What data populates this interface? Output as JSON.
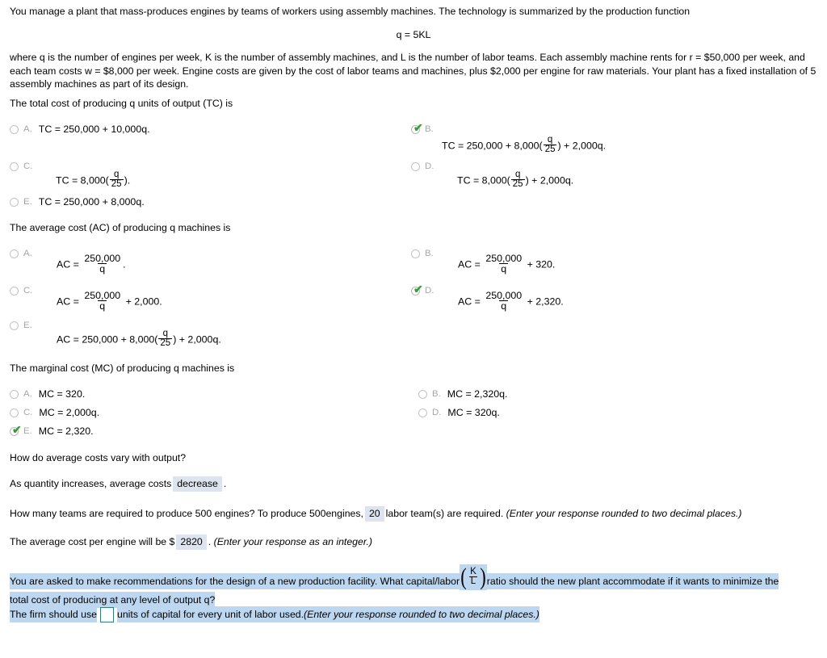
{
  "problem": {
    "intro": "You manage a plant that mass-produces engines by teams of workers using assembly machines. The technology is summarized by the production function",
    "equation": "q = 5KL",
    "details": "where q is the number of engines per week, K is the number of assembly machines, and L is the number of labor teams. Each assembly machine rents for r = $50,000 per week, and each team costs w = $8,000 per week. Engine costs are given by the cost of labor teams and machines, plus $2,000 per engine for raw materials. Your plant has a fixed installation of 5 assembly machines as part of its design."
  },
  "questions": [
    {
      "prompt": "The total cost of producing q units of output (TC) is",
      "options": [
        {
          "letter": "A.",
          "selected": false,
          "pre": "TC = 250,000 + 10,000q.",
          "frac": null,
          "post": ""
        },
        {
          "letter": "B.",
          "selected": true,
          "pre": "TC = 250,000 + 8,000(",
          "frac": {
            "num": "q",
            "den": "25"
          },
          "post": ") + 2,000q."
        },
        {
          "letter": "C.",
          "selected": false,
          "pre": "TC = 8,000(",
          "frac": {
            "num": "q",
            "den": "25"
          },
          "post": ")."
        },
        {
          "letter": "D.",
          "selected": false,
          "pre": "TC = 8,000(",
          "frac": {
            "num": "q",
            "den": "25"
          },
          "post": ") + 2,000q."
        },
        {
          "letter": "E.",
          "selected": false,
          "pre": "TC = 250,000 + 8,000q.",
          "frac": null,
          "post": ""
        }
      ]
    },
    {
      "prompt": "The average cost (AC) of producing q machines is",
      "options": [
        {
          "letter": "A.",
          "selected": false,
          "pre": "AC = ",
          "frac": {
            "num": "250,000",
            "den": "q"
          },
          "post": "."
        },
        {
          "letter": "B.",
          "selected": false,
          "pre": "AC = ",
          "frac": {
            "num": "250,000",
            "den": "q"
          },
          "post": " + 320."
        },
        {
          "letter": "C.",
          "selected": false,
          "pre": "AC = ",
          "frac": {
            "num": "250,000",
            "den": "q"
          },
          "post": " + 2,000."
        },
        {
          "letter": "D.",
          "selected": true,
          "pre": "AC = ",
          "frac": {
            "num": "250,000",
            "den": "q"
          },
          "post": " + 2,320."
        },
        {
          "letter": "E.",
          "selected": false,
          "pre": "AC = 250,000 + 8,000(",
          "frac": {
            "num": "q",
            "den": "25"
          },
          "post": ") + 2,000q."
        }
      ]
    },
    {
      "prompt": "The marginal cost (MC) of producing q machines is",
      "options": [
        {
          "letter": "A.",
          "selected": false,
          "pre": "MC = 320.",
          "frac": null,
          "post": ""
        },
        {
          "letter": "B.",
          "selected": false,
          "pre": "MC = 2,320q.",
          "frac": null,
          "post": ""
        },
        {
          "letter": "C.",
          "selected": false,
          "pre": "MC = 2,000q.",
          "frac": null,
          "post": ""
        },
        {
          "letter": "D.",
          "selected": false,
          "pre": "MC = 320q.",
          "frac": null,
          "post": ""
        },
        {
          "letter": "E.",
          "selected": true,
          "pre": "MC = 2,320.",
          "frac": null,
          "post": ""
        }
      ]
    }
  ],
  "fill_ins": {
    "q4_prompt": "How do average costs vary with output?",
    "q4_pre": "As quantity increases, average costs",
    "q4_value": "decrease",
    "q4_post": ".",
    "q5_pre": "How many teams are required to produce 500 engines? To produce 500engines,",
    "q5_value": "20",
    "q5_mid": "labor team(s) are required.",
    "q5_hint": "(Enter your response rounded to two decimal places.)",
    "q6_pre": "The average cost per engine will be $",
    "q6_value": "2820",
    "q6_post": ".",
    "q6_hint": "(Enter your response as an integer.)"
  },
  "highlighted": {
    "line_a": "You are asked to make recommendations for the design of a new production facility. What capital/labor",
    "ratio_num": "K",
    "ratio_den": "L",
    "line_b": "ratio should the new plant accommodate if it wants to minimize the",
    "line_c": "total cost of producing at any level of output q?",
    "final_pre": "The firm should use",
    "final_value": "",
    "final_post": "units of capital for every unit of labor used.",
    "final_hint": "(Enter your response rounded to two decimal places.)"
  },
  "colors": {
    "highlight_blue": "#bdd7f1",
    "field_blue": "#dde4f0",
    "check_green": "#3a9a3a",
    "input_border": "#2e7d84"
  }
}
